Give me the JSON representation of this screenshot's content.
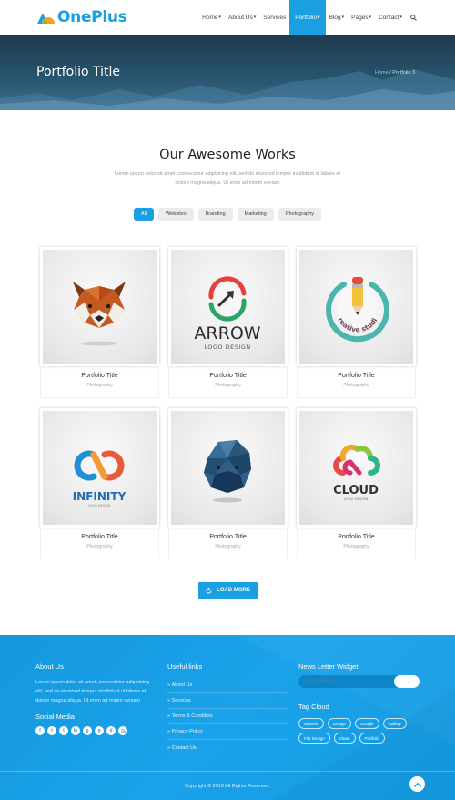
{
  "brand": {
    "name": "OnePlus"
  },
  "nav": {
    "items": [
      {
        "label": "Home",
        "caret": "▾"
      },
      {
        "label": "About Us",
        "caret": "▾"
      },
      {
        "label": "Services",
        "caret": ""
      },
      {
        "label": "Portfolio",
        "caret": "▾"
      },
      {
        "label": "Blog",
        "caret": "▾"
      },
      {
        "label": "Pages",
        "caret": "▾"
      },
      {
        "label": "Contact",
        "caret": "▾"
      }
    ],
    "search_icon": "search-icon"
  },
  "hero": {
    "title": "Portfolio Title",
    "breadcrumb": {
      "home": "Home",
      "separator": "/",
      "current": "Portfolio 3"
    }
  },
  "section": {
    "title": "Our Awesome Works",
    "description": "Lorem ipsum dolor sit amet, consectetur adipisicing elit, sed do eiusmod tempor incididunt ut labore et dolore magna aliqua. Ut enim ad minim veniam"
  },
  "filters": [
    "All",
    "Websites",
    "Branding",
    "Marketing",
    "Photography"
  ],
  "portfolio": [
    {
      "title": "Portfolio Title",
      "category": "Photography",
      "image": "red-panda-lowpoly"
    },
    {
      "title": "Portfolio Title",
      "category": "Photography",
      "image": "arrow-logo",
      "logo_text": "ARROW",
      "logo_sub": "LOGO DESIGN"
    },
    {
      "title": "Portfolio Title",
      "category": "Photography",
      "image": "creative-studio-logo",
      "logo_text": "creative studio"
    },
    {
      "title": "Portfolio Title",
      "category": "Photography",
      "image": "infinity-logo",
      "logo_text": "INFINITY",
      "logo_sub": "LOGO DESIGN"
    },
    {
      "title": "Portfolio Title",
      "category": "Photography",
      "image": "lowpoly-creature"
    },
    {
      "title": "Portfolio Title",
      "category": "Photography",
      "image": "cloud-logo",
      "logo_text": "CLOUD",
      "logo_sub": "LOGO DESIGN"
    }
  ],
  "load_more": {
    "label": "LOAD MORE"
  },
  "footer": {
    "about": {
      "title": "About Us",
      "text": "Lorem ipsum dolor sit amet, consectetur adipisicing elit, sed do eiusmod tempor incididunt ut labore et dolore magna aliqua. Ut enim ad minim veniam"
    },
    "social": {
      "title": "Social Media",
      "icons": [
        "f",
        "t",
        "t",
        "in",
        "g",
        "p",
        "d",
        "rss"
      ]
    },
    "useful_links": {
      "title": "Useful links",
      "items": [
        "About Us",
        "Services",
        "Terms & Condition",
        "Privacy Policy",
        "Contact Us"
      ]
    },
    "newsletter": {
      "title": "News Letter Widget",
      "placeholder": "Email Address",
      "button": "→"
    },
    "tag_cloud": {
      "title": "Tag Cloud",
      "tags": [
        "Material",
        "Design",
        "Google",
        "Gallery",
        "Flat Design",
        "Clean",
        "Portfolio"
      ]
    },
    "copyright": "Copyright © 2016 All Rights Reserved.",
    "back_to_top": "^"
  },
  "colors": {
    "accent": "#1a9fe0",
    "hero_dark": "#1f3a4e",
    "footer": "#1597df"
  }
}
